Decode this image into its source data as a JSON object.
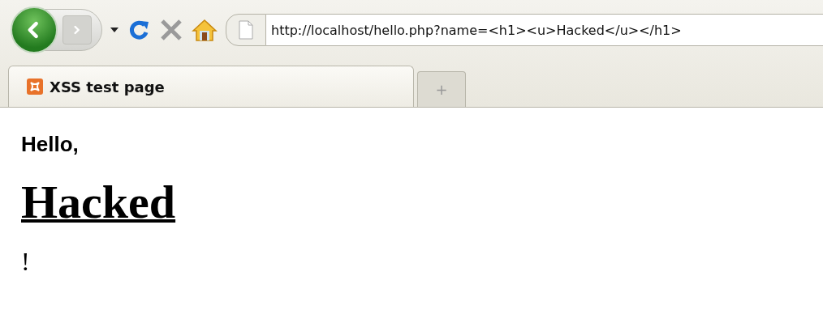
{
  "toolbar": {
    "address": {
      "value": "http://localhost/hello.php?name=<h1><u>Hacked</u></h1>"
    }
  },
  "tabs": [
    {
      "label": "XSS test page",
      "selected": true
    }
  ],
  "new_tab": {
    "label": "+"
  },
  "page": {
    "paragraphs": [
      {
        "kind": "text",
        "text": "Hello,"
      },
      {
        "kind": "heading",
        "text": "Hacked"
      },
      {
        "kind": "text-serif",
        "text": "!"
      }
    ]
  }
}
